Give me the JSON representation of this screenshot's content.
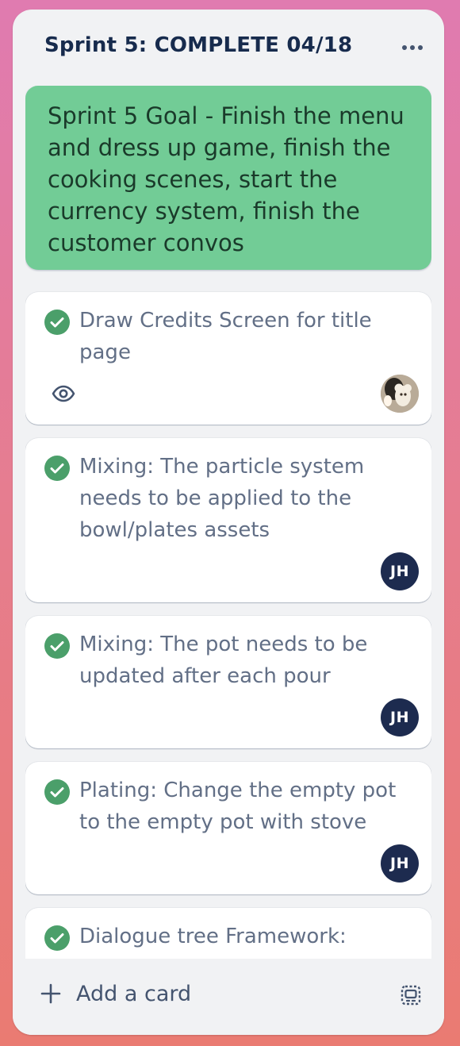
{
  "list": {
    "title": "Sprint 5: COMPLETE 04/18",
    "menu_icon": "more-horizontal-icon"
  },
  "goal_card": {
    "text": "Sprint 5 Goal - Finish the menu and dress up game, finish the cooking scenes, start the currency system, finish the customer convos",
    "color": "#72cc96"
  },
  "cards": [
    {
      "title": "Draw Credits Screen for title page",
      "status_icon": "check-circle-icon",
      "badge_icon": "eye-icon",
      "member": "photo-avatar"
    },
    {
      "title": "Mixing: The particle system needs to be applied to the bowl/plates assets",
      "status_icon": "check-circle-icon",
      "member_initials": "JH"
    },
    {
      "title": "Mixing: The pot needs to be updated after each pour",
      "status_icon": "check-circle-icon",
      "member_initials": "JH"
    },
    {
      "title": "Plating: Change the empty pot to the empty pot with stove",
      "status_icon": "check-circle-icon",
      "member_initials": "JH"
    },
    {
      "title": "Dialogue tree Framework: Create a system for branching",
      "status_icon": "check-circle-icon"
    }
  ],
  "footer": {
    "add_card_label": "Add a card",
    "plus_icon": "plus-icon",
    "template_icon": "card-template-icon"
  },
  "colors": {
    "complete_green": "#4b9f6a",
    "avatar_navy": "#1d2b4f",
    "list_bg": "#f1f2f4"
  }
}
